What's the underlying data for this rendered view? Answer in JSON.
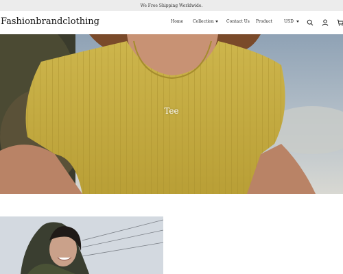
{
  "announcement": {
    "text": "We Free Shipping Worldwide."
  },
  "header": {
    "logo": "Fashionbrandclothing",
    "nav": [
      {
        "label": "Home"
      },
      {
        "label": "Collection",
        "has_dropdown": true
      },
      {
        "label": "Contact Us"
      },
      {
        "label": "Product"
      }
    ],
    "currency": "USD",
    "icons": [
      "search-icon",
      "account-icon",
      "cart-icon"
    ]
  },
  "hero": {
    "title": "Tee"
  },
  "colors": {
    "announcement_bg": "#ececec",
    "hero_shirt": "#c9b24a",
    "text": "#111111"
  }
}
